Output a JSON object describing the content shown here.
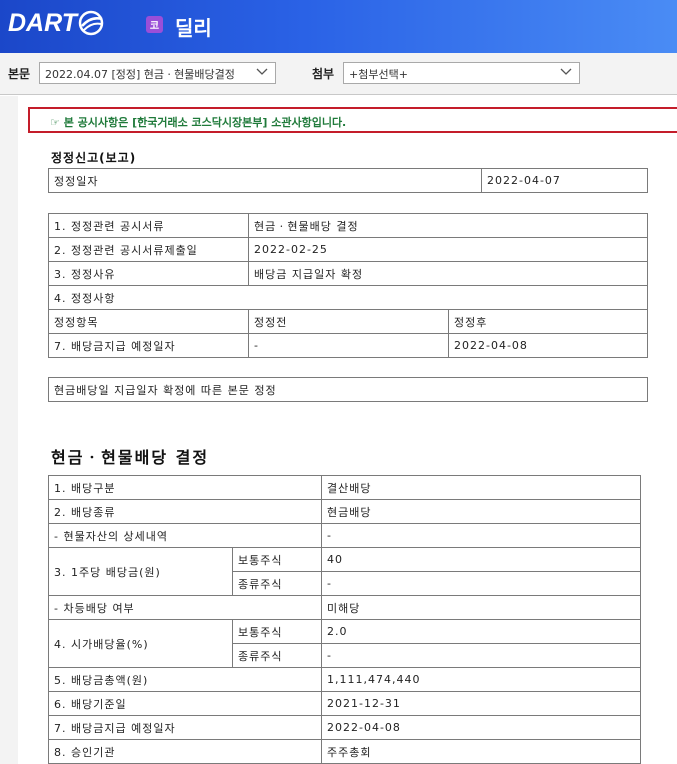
{
  "header": {
    "logo_text": "DART",
    "market_badge": "코",
    "company_name": "딜리"
  },
  "toolbar": {
    "body_label": "본문",
    "body_select": "2022.04.07 [정정] 현금ㆍ현물배당결정",
    "attach_label": "첨부",
    "attach_select": "+첨부선택+"
  },
  "notice": "☞ 본 공시사항은 [한국거래소 코스닥시장본부] 소관사항입니다.",
  "correction": {
    "title": "정정신고(보고)",
    "date_label": "정정일자",
    "date_value": "2022-04-07",
    "rows": [
      {
        "label": "1. 정정관련 공시서류",
        "value": "현금ㆍ현물배당 결정"
      },
      {
        "label": "2. 정정관련 공시서류제출일",
        "value": "2022-02-25"
      },
      {
        "label": "3. 정정사유",
        "value": "배당금 지급일자 확정"
      }
    ],
    "item4_label": "4. 정정사항",
    "headers": {
      "item": "정정항목",
      "before": "정정전",
      "after": "정정후"
    },
    "change_row": {
      "item": "7. 배당금지급 예정일자",
      "before": "-",
      "after": "2022-04-08"
    },
    "remark": "현금배당일 지급일자 확정에 따른 본문 정정"
  },
  "dividend": {
    "title": "현금ㆍ현물배당 결정",
    "r1_label": "1. 배당구분",
    "r1_value": "결산배당",
    "r2_label": "2. 배당종류",
    "r2_value": "현금배당",
    "r3_label": "- 현물자산의 상세내역",
    "r3_value": "-",
    "r4_label": "3. 1주당 배당금(원)",
    "r4_sub1": "보통주식",
    "r4_val1": "40",
    "r4_sub2": "종류주식",
    "r4_val2": "-",
    "r5_label": "- 차등배당 여부",
    "r5_value": "미해당",
    "r6_label": "4. 시가배당율(%)",
    "r6_sub1": "보통주식",
    "r6_val1": "2.0",
    "r6_sub2": "종류주식",
    "r6_val2": "-",
    "r7_label": "5. 배당금총액(원)",
    "r7_value": "1,111,474,440",
    "r8_label": "6. 배당기준일",
    "r8_value": "2021-12-31",
    "r9_label": "7. 배당금지급 예정일자",
    "r9_value": "2022-04-08",
    "r10_label": "8. 승인기관",
    "r10_value": "주주총회"
  }
}
